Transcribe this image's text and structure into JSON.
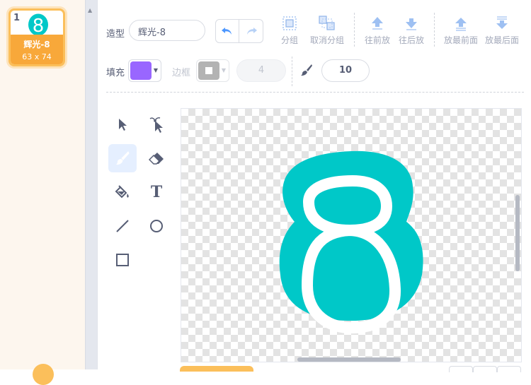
{
  "costume_list": {
    "items": [
      {
        "index": "1",
        "name": "辉光-8",
        "size": "63 x 74",
        "thumb_glyph": "8",
        "selected": true
      }
    ]
  },
  "toolbar": {
    "costume_label": "造型",
    "costume_name": "辉光-8",
    "group_label": "分组",
    "ungroup_label": "取消分组",
    "forward_label": "往前放",
    "backward_label": "往后放",
    "front_label": "放最前面",
    "back_label": "放最后面",
    "fill_label": "填充",
    "outline_label": "边框",
    "outline_width": "4",
    "brush_size": "10"
  },
  "colors": {
    "fill": "#9966ff",
    "outline": "#b3b3b3",
    "accent": "#4c97ff",
    "selection": "#fbbf5b",
    "glyph_fill": "#00c8c8"
  },
  "tools": [
    {
      "name": "select-tool",
      "icon": "arrow-icon"
    },
    {
      "name": "reshape-tool",
      "icon": "reshape-icon"
    },
    {
      "name": "brush-tool",
      "icon": "brush-icon",
      "active": true
    },
    {
      "name": "eraser-tool",
      "icon": "eraser-icon"
    },
    {
      "name": "fill-tool",
      "icon": "bucket-icon"
    },
    {
      "name": "text-tool",
      "icon": "text-icon",
      "glyph": "T"
    },
    {
      "name": "line-tool",
      "icon": "line-icon"
    },
    {
      "name": "circle-tool",
      "icon": "circle-icon"
    },
    {
      "name": "rectangle-tool",
      "icon": "rectangle-icon"
    }
  ],
  "canvas": {
    "glyph": "8"
  }
}
